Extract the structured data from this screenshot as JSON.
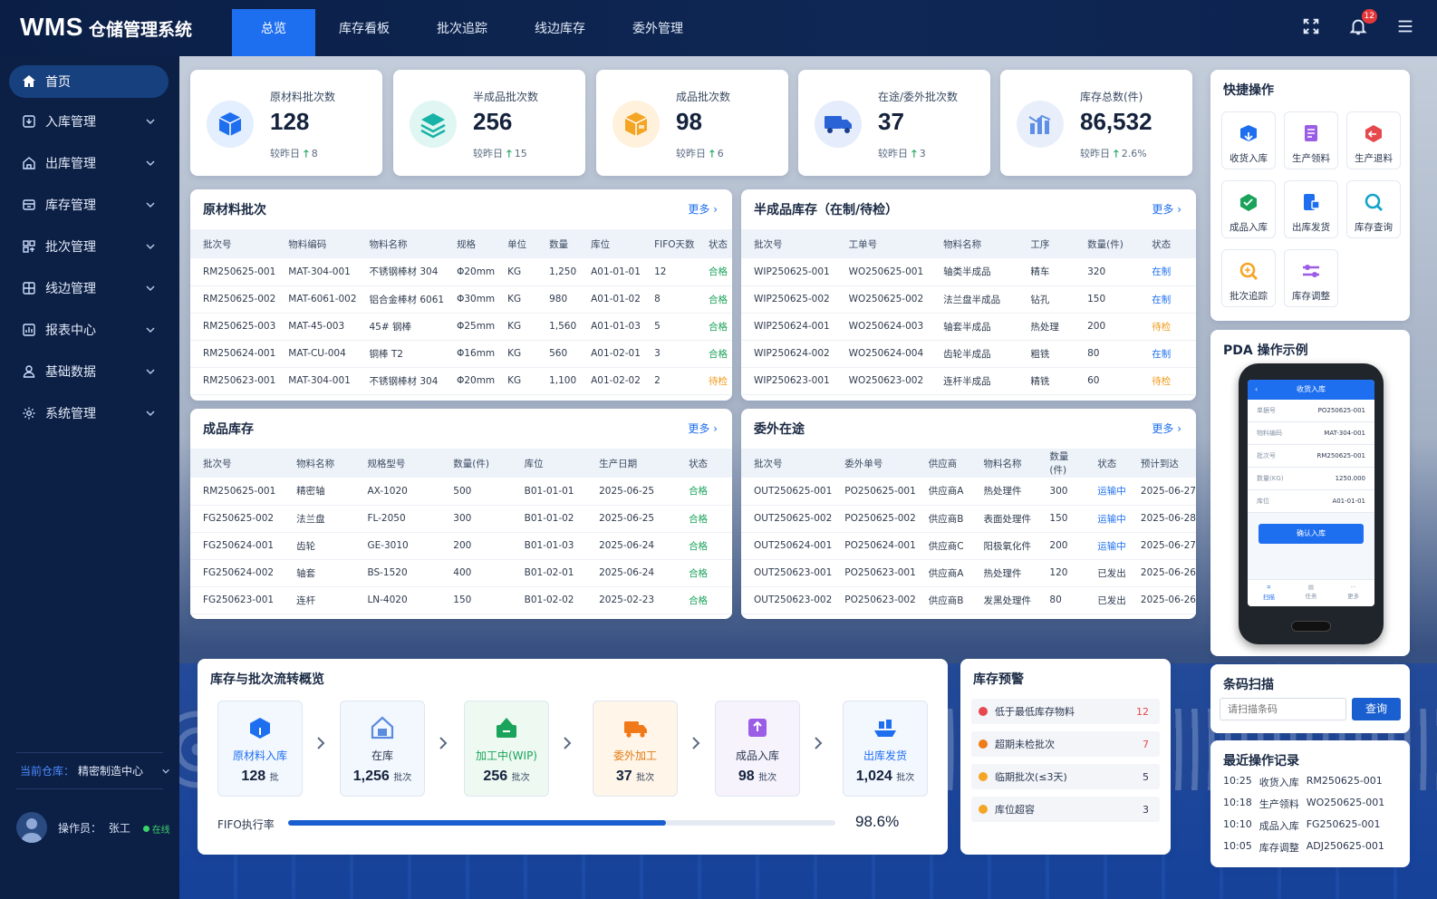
{
  "app": {
    "logo_en": "WMS",
    "logo_cn": "仓储管理系统"
  },
  "topnav": [
    "总览",
    "库存看板",
    "批次追踪",
    "线边库存",
    "委外管理"
  ],
  "notifications": {
    "count": "12"
  },
  "sidebar": {
    "items": [
      {
        "label": "首页",
        "icon": "home-icon"
      },
      {
        "label": "入库管理",
        "icon": "inbound-icon"
      },
      {
        "label": "出库管理",
        "icon": "outbound-icon"
      },
      {
        "label": "库存管理",
        "icon": "inventory-icon"
      },
      {
        "label": "批次管理",
        "icon": "batch-icon"
      },
      {
        "label": "线边管理",
        "icon": "lineside-icon"
      },
      {
        "label": "报表中心",
        "icon": "report-icon"
      },
      {
        "label": "基础数据",
        "icon": "user-icon"
      },
      {
        "label": "系统管理",
        "icon": "settings-icon"
      }
    ],
    "warehouse_label": "当前仓库：",
    "warehouse_value": "精密制造中心",
    "operator_label": "操作员：",
    "operator_name": "张工",
    "online": "在线"
  },
  "stats": [
    {
      "label": "原材料批次数",
      "value": "128",
      "cmp_label": "较昨日",
      "delta": "8",
      "color": "#1e6ff0",
      "bg": "#e3eefe"
    },
    {
      "label": "半成品批次数",
      "value": "256",
      "cmp_label": "较昨日",
      "delta": "15",
      "color": "#16b3a6",
      "bg": "#dff6f2"
    },
    {
      "label": "成品批次数",
      "value": "98",
      "cmp_label": "较昨日",
      "delta": "6",
      "color": "#f5a524",
      "bg": "#fff1dc"
    },
    {
      "label": "在途/委外批次数",
      "value": "37",
      "cmp_label": "较昨日",
      "delta": "3",
      "color": "#2a63d6",
      "bg": "#e5ecfb"
    },
    {
      "label": "库存总数(件)",
      "value": "86,532",
      "cmp_label": "较昨日",
      "delta": "2.6%",
      "color": "#5e8fe6",
      "bg": "#e9effa"
    }
  ],
  "raw": {
    "title": "原材料批次",
    "more": "更多 ›",
    "headers": [
      "批次号",
      "物料编码",
      "物料名称",
      "规格",
      "单位",
      "数量",
      "库位",
      "FIFO天数",
      "状态"
    ],
    "rows": [
      [
        "RM250625-001",
        "MAT-304-001",
        "不锈钢棒材 304",
        "Φ20mm",
        "KG",
        "1,250",
        "A01-01-01",
        "12",
        "合格"
      ],
      [
        "RM250625-002",
        "MAT-6061-002",
        "铝合金棒材 6061",
        "Φ30mm",
        "KG",
        "980",
        "A01-01-02",
        "8",
        "合格"
      ],
      [
        "RM250625-003",
        "MAT-45-003",
        "45# 钢棒",
        "Φ25mm",
        "KG",
        "1,560",
        "A01-01-03",
        "5",
        "合格"
      ],
      [
        "RM250624-001",
        "MAT-CU-004",
        "铜棒 T2",
        "Φ16mm",
        "KG",
        "560",
        "A01-02-01",
        "3",
        "合格"
      ],
      [
        "RM250623-001",
        "MAT-304-001",
        "不锈钢棒材 304",
        "Φ20mm",
        "KG",
        "1,100",
        "A01-02-02",
        "2",
        "待检"
      ]
    ]
  },
  "semi": {
    "title": "半成品库存（在制/待检）",
    "more": "更多 ›",
    "headers": [
      "批次号",
      "工单号",
      "物料名称",
      "工序",
      "数量(件)",
      "状态"
    ],
    "rows": [
      [
        "WIP250625-001",
        "WO250625-001",
        "轴类半成品",
        "精车",
        "320",
        "在制"
      ],
      [
        "WIP250625-002",
        "WO250625-002",
        "法兰盘半成品",
        "钻孔",
        "150",
        "在制"
      ],
      [
        "WIP250624-001",
        "WO250624-003",
        "轴套半成品",
        "热处理",
        "200",
        "待检"
      ],
      [
        "WIP250624-002",
        "WO250624-004",
        "齿轮半成品",
        "粗铣",
        "80",
        "在制"
      ],
      [
        "WIP250623-001",
        "WO250623-002",
        "连杆半成品",
        "精铣",
        "60",
        "待检"
      ]
    ]
  },
  "fg": {
    "title": "成品库存",
    "more": "更多 ›",
    "headers": [
      "批次号",
      "物料名称",
      "规格型号",
      "数量(件)",
      "库位",
      "生产日期",
      "状态"
    ],
    "rows": [
      [
        "RM250625-001",
        "精密轴",
        "AX-1020",
        "500",
        "B01-01-01",
        "2025-06-25",
        "合格"
      ],
      [
        "FG250625-002",
        "法兰盘",
        "FL-2050",
        "300",
        "B01-01-02",
        "2025-06-25",
        "合格"
      ],
      [
        "FG250624-001",
        "齿轮",
        "GE-3010",
        "200",
        "B01-01-03",
        "2025-06-24",
        "合格"
      ],
      [
        "FG250624-002",
        "轴套",
        "BS-1520",
        "400",
        "B01-02-01",
        "2025-06-24",
        "合格"
      ],
      [
        "FG250623-001",
        "连杆",
        "LN-4020",
        "150",
        "B01-02-02",
        "2025-02-23",
        "合格"
      ]
    ]
  },
  "out": {
    "title": "委外在途",
    "more": "更多 ›",
    "headers": [
      "批次号",
      "委外单号",
      "供应商",
      "物料名称",
      "数量(件)",
      "状态",
      "预计到达"
    ],
    "rows": [
      [
        "OUT250625-001",
        "PO250625-001",
        "供应商A",
        "热处理件",
        "300",
        "运输中",
        "2025-06-27"
      ],
      [
        "OUT250625-002",
        "PO250625-002",
        "供应商B",
        "表面处理件",
        "150",
        "运输中",
        "2025-06-28"
      ],
      [
        "OUT250624-001",
        "PO250624-001",
        "供应商C",
        "阳极氧化件",
        "200",
        "运输中",
        "2025-06-27"
      ],
      [
        "OUT250623-001",
        "PO250623-001",
        "供应商A",
        "热处理件",
        "120",
        "已发出",
        "2025-06-26"
      ],
      [
        "OUT250623-002",
        "PO250623-002",
        "供应商B",
        "发黑处理件",
        "80",
        "已发出",
        "2025-06-26"
      ]
    ]
  },
  "quick": {
    "title": "快捷操作",
    "items": [
      {
        "label": "收货入库",
        "icon": "receive-icon",
        "color": "#1e6ff0"
      },
      {
        "label": "生产领料",
        "icon": "pick-icon",
        "color": "#9b5de5"
      },
      {
        "label": "生产退料",
        "icon": "return-icon",
        "color": "#e5484d"
      },
      {
        "label": "成品入库",
        "icon": "fg-inbound-icon",
        "color": "#1aa35a"
      },
      {
        "label": "出库发货",
        "icon": "ship-icon",
        "color": "#1e6ff0"
      },
      {
        "label": "库存查询",
        "icon": "search-icon",
        "color": "#16a3c9"
      },
      {
        "label": "批次追踪",
        "icon": "trace-icon",
        "color": "#f5a524"
      },
      {
        "label": "库存调整",
        "icon": "adjust-icon",
        "color": "#9b5de5"
      }
    ]
  },
  "pda": {
    "title": "PDA 操作示例",
    "screen_title": "收货入库",
    "fields": [
      [
        "单据号",
        "PO250625-001"
      ],
      [
        "物料编码",
        "MAT-304-001"
      ],
      [
        "批次号",
        "RM250625-001"
      ],
      [
        "数量(KG)",
        "1250.000"
      ],
      [
        "库位",
        "A01-01-01"
      ]
    ],
    "button": "确认入库",
    "tabs": [
      "扫描",
      "任务",
      "更多"
    ]
  },
  "scan": {
    "title": "条码扫描",
    "placeholder": "请扫描条码",
    "button": "查询"
  },
  "recent": {
    "title": "最近操作记录",
    "rows": [
      [
        "10:25",
        "收货入库",
        "RM250625-001"
      ],
      [
        "10:18",
        "生产领料",
        "WO250625-001"
      ],
      [
        "10:10",
        "成品入库",
        "FG250625-001"
      ],
      [
        "10:05",
        "库存调整",
        "ADJ250625-001"
      ]
    ]
  },
  "flow": {
    "title": "库存与批次流转概览",
    "steps": [
      {
        "label": "原材料入库",
        "value": "128",
        "unit": "批",
        "color": "#1e6ff0",
        "bg": "#f3f7fe",
        "icon": "raw-inbound-icon"
      },
      {
        "label": "在库",
        "value": "1,256",
        "unit": "批次",
        "color": "#2b3850",
        "bg": "#f3f7fe",
        "icon": "in-stock-icon"
      },
      {
        "label": "加工中(WIP)",
        "value": "256",
        "unit": "批次",
        "color": "#1aa35a",
        "bg": "#eef9f2",
        "icon": "wip-icon"
      },
      {
        "label": "委外加工",
        "value": "37",
        "unit": "批次",
        "color": "#e07b12",
        "bg": "#fff5e9",
        "icon": "outsource-icon"
      },
      {
        "label": "成品入库",
        "value": "98",
        "unit": "批次",
        "color": "#2b3850",
        "bg": "#f6f3fd",
        "icon": "fg-box-icon"
      },
      {
        "label": "出库发货",
        "value": "1,024",
        "unit": "批次",
        "color": "#1e6ff0",
        "bg": "#f3f7fe",
        "icon": "ship-out-icon"
      }
    ],
    "fifo_label": "FIFO执行率",
    "fifo_value": "98.6%",
    "fifo_fraction": 0.69
  },
  "alerts": {
    "title": "库存预警",
    "rows": [
      {
        "label": "低于最低库存物料",
        "count": "12",
        "color": "#e5484d",
        "count_color": "#e5484d"
      },
      {
        "label": "超期未检批次",
        "count": "7",
        "color": "#f07a1a",
        "count_color": "#e5484d"
      },
      {
        "label": "临期批次(≤3天)",
        "count": "5",
        "color": "#f5a524",
        "count_color": "#2b3850"
      },
      {
        "label": "库位超容",
        "count": "3",
        "color": "#f5a524",
        "count_color": "#2b3850"
      }
    ]
  }
}
